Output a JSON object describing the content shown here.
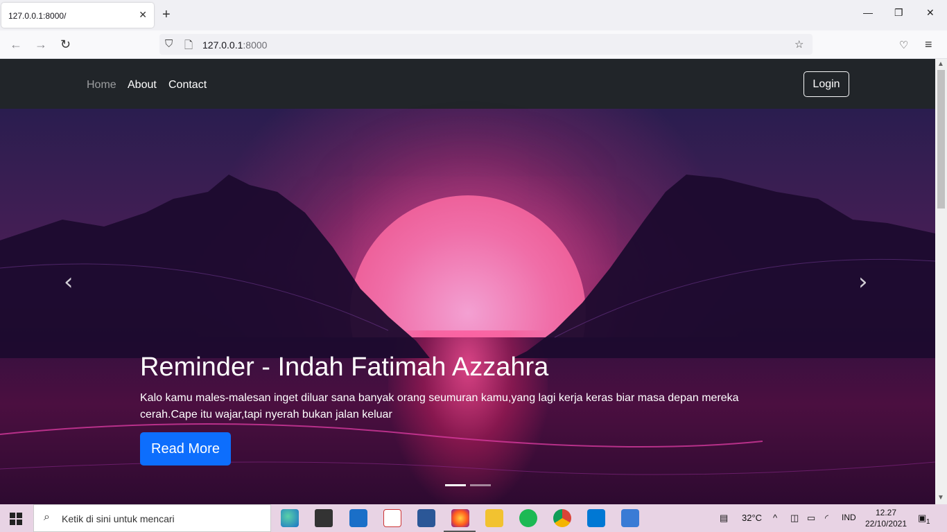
{
  "browser": {
    "tab_title": "127.0.0.1:8000/",
    "tab_close": "✕",
    "new_tab": "+",
    "url_host": "127.0.0.1",
    "url_port": ":8000"
  },
  "site": {
    "nav": [
      "Home",
      "About",
      "Contact"
    ],
    "login": "Login"
  },
  "carousel": {
    "title": "Reminder - Indah Fatimah Azzahra",
    "text": "Kalo kamu males-malesan inget diluar sana banyak orang seumuran kamu,yang lagi kerja keras biar masa depan mereka cerah.Cape itu wajar,tapi nyerah bukan jalan keluar",
    "button": "Read More",
    "prev": "‹",
    "next": "›"
  },
  "taskbar": {
    "search_placeholder": "Ketik di sini untuk mencari",
    "weather": "32°C",
    "language": "IND",
    "time": "12.27",
    "date": "22/10/2021",
    "notifications": "1"
  },
  "colors": {
    "site_nav": "#212529",
    "primary_button": "#0d6efd",
    "taskbar": "#e8d3e4"
  }
}
